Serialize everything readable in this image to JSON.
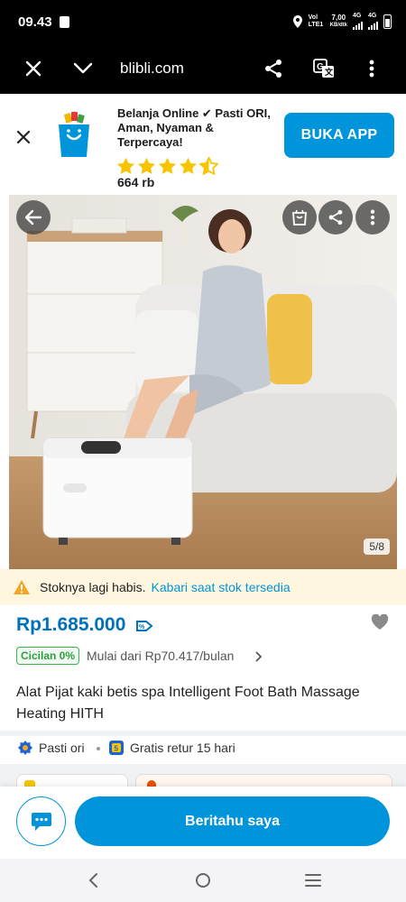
{
  "status_bar": {
    "time": "09.43",
    "net_label": "Vol LTE1",
    "speed": "7,00",
    "speed_unit": "KB/dtk",
    "sig1": "4G",
    "sig2": "4G"
  },
  "browser": {
    "url": "blibli.com",
    "icons": [
      "close-icon",
      "chevron-down-icon",
      "share-icon",
      "translate-icon",
      "more-vertical-icon"
    ]
  },
  "app_banner": {
    "text": "Belanja Online ✔ Pasti ORI, Aman, Nyaman & Terpercaya!",
    "rating_value": 4.5,
    "rating_count": "664 rb",
    "button_label": "BUKA APP",
    "colors": {
      "accent": "#0095da",
      "star": "#f7c400"
    }
  },
  "product_image": {
    "counter": "5/8",
    "overlay_icons": [
      "back-arrow-icon",
      "bag-icon",
      "share-icon",
      "more-vertical-icon"
    ]
  },
  "stock_alert": {
    "text": "Stoknya lagi habis.",
    "link": "Kabari saat stok tersedia",
    "icon": "warning-icon",
    "color": "#f5a623"
  },
  "product": {
    "price": "Rp1.685.000",
    "installment_badge": "Cicilan 0%",
    "installment_text": "Mulai dari Rp70.417/bulan",
    "title": "Alat Pijat kaki betis spa Intelligent Foot Bath Massage Heating HITH"
  },
  "features": [
    {
      "icon": "original-badge-icon",
      "label": "Pasti ori"
    },
    {
      "icon": "return-badge-icon",
      "label": "Gratis retur 15 hari"
    }
  ],
  "bottom_bar": {
    "notify_label": "Beritahu saya",
    "chat_icon": "chat-icon"
  },
  "nav_bar": {
    "icons": [
      "back-icon",
      "home-icon",
      "recents-icon"
    ]
  }
}
